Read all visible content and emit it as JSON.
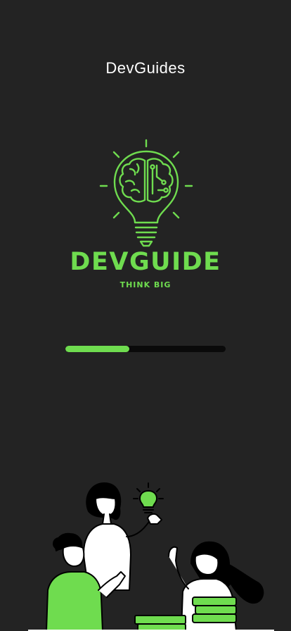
{
  "app": {
    "title": "DevGuides"
  },
  "logo": {
    "brand_name": "DEVGUIDE",
    "tagline": "THINK BIG",
    "icon": "brain-lightbulb-icon"
  },
  "loading": {
    "progress_fraction": 0.4
  },
  "illustration": {
    "icon": "people-studying-illustration"
  },
  "colors": {
    "background": "#232323",
    "accent": "#6fdc4f",
    "track": "#0a0a0a",
    "text": "#ffffff"
  }
}
